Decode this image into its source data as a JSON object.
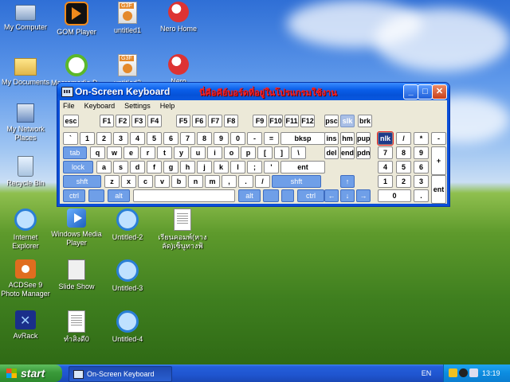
{
  "desktop": {
    "icons": [
      {
        "label": "My Computer"
      },
      {
        "label": "GOM Player"
      },
      {
        "label": "untitled1"
      },
      {
        "label": "Nero Home"
      },
      {
        "label": "My Documents"
      },
      {
        "label": "Macromedia D..."
      },
      {
        "label": "untitled2"
      },
      {
        "label": "Nero"
      },
      {
        "label": "My Network Places"
      },
      {
        "label": "Recycle Bin"
      },
      {
        "label": "Internet Explorer"
      },
      {
        "label": "Windows Media Player"
      },
      {
        "label": "Untitled-2"
      },
      {
        "label": "เรียนคอมพ์(หาง ลัด)เซ็นูทางฟ้"
      },
      {
        "label": "ACDSee 9 Photo Manager"
      },
      {
        "label": "Slide Show"
      },
      {
        "label": "Untitled-3"
      },
      {
        "label": "AvRack"
      },
      {
        "label": "ทำสิ่งดี0"
      },
      {
        "label": "Untitled-4"
      }
    ]
  },
  "window": {
    "title": "On-Screen Keyboard",
    "overlay_text": "นี่คือคีย์บอร์ดที่อยู่ในโปรแกรมใช้งาน",
    "buttons": {
      "minimize": "_",
      "maximize": "□",
      "close": "✕"
    },
    "menu": [
      "File",
      "Keyboard",
      "Settings",
      "Help"
    ]
  },
  "keyboard": {
    "row0": [
      "esc",
      "F1",
      "F2",
      "F3",
      "F4",
      "F5",
      "F6",
      "F7",
      "F8",
      "F9",
      "F10",
      "F11",
      "F12",
      "psc",
      "slk",
      "brk"
    ],
    "row1": [
      "`",
      "1",
      "2",
      "3",
      "4",
      "5",
      "6",
      "7",
      "8",
      "9",
      "0",
      "-",
      "=",
      "bksp",
      "ins",
      "hm",
      "pup",
      "nlk",
      "/",
      "*",
      "-"
    ],
    "row2": [
      "tab",
      "q",
      "w",
      "e",
      "r",
      "t",
      "y",
      "u",
      "i",
      "o",
      "p",
      "[",
      "]",
      "\\",
      "del",
      "end",
      "pdn",
      "7",
      "8",
      "9",
      "+"
    ],
    "row3": [
      "lock",
      "a",
      "s",
      "d",
      "f",
      "g",
      "h",
      "j",
      "k",
      "l",
      ";",
      "'",
      "ent",
      "4",
      "5",
      "6"
    ],
    "row4": [
      "shft",
      "z",
      "x",
      "c",
      "v",
      "b",
      "n",
      "m",
      ",",
      ".",
      "/",
      "shft",
      "↑",
      "1",
      "2",
      "3",
      "ent"
    ],
    "row5": [
      "ctrl",
      "alt",
      "alt",
      "ctrl",
      "←",
      "↓",
      "→",
      "0",
      "."
    ]
  },
  "taskbar": {
    "start_label": "start",
    "task_label": "On-Screen Keyboard",
    "language": "EN",
    "clock": "13:19"
  },
  "colors": {
    "title_bar": "#0a58e0",
    "mod_key": "#6f9fe8",
    "start_green": "#3a9a3a",
    "banner_red": "#ff2020"
  }
}
